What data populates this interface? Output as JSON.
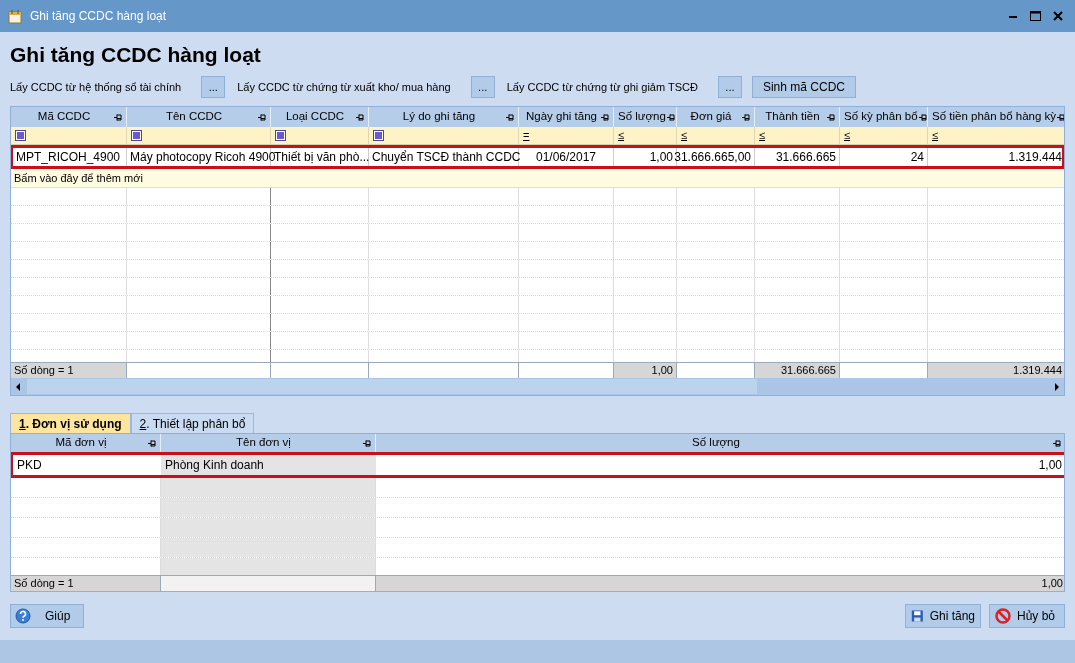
{
  "window": {
    "title": "Ghi tăng CCDC hàng loạt"
  },
  "heading": "Ghi tăng CCDC hàng loạt",
  "toolbar": [
    {
      "kind": "label",
      "text": "Lấy CCDC từ hệ thống sổ tài chính"
    },
    {
      "kind": "picker",
      "text": "..."
    },
    {
      "kind": "label",
      "text": "Lấy CCDC từ chứng từ xuất kho/ mua hàng"
    },
    {
      "kind": "picker",
      "text": "..."
    },
    {
      "kind": "label",
      "text": "Lấy CCDC từ chứng từ ghi giảm TSCĐ"
    },
    {
      "kind": "picker",
      "text": "..."
    },
    {
      "kind": "button",
      "text": "Sinh mã CCDC"
    }
  ],
  "main_grid": {
    "columns": [
      {
        "label": "Mã CCDC",
        "filter": {
          "kind": "checkbox",
          "checked": true
        }
      },
      {
        "label": "Tên CCDC",
        "filter": {
          "kind": "checkbox",
          "checked": true
        }
      },
      {
        "label": "Loại CCDC",
        "filter": {
          "kind": "checkbox",
          "checked": true
        }
      },
      {
        "label": "Lý do ghi tăng",
        "filter": {
          "kind": "checkbox",
          "checked": true
        }
      },
      {
        "label": "Ngày ghi tăng",
        "filter": {
          "kind": "operator",
          "symbol": "="
        }
      },
      {
        "label": "Số lượng",
        "filter": {
          "kind": "operator",
          "symbol": "≤"
        }
      },
      {
        "label": "Đơn giá",
        "filter": {
          "kind": "operator",
          "symbol": "≤"
        }
      },
      {
        "label": "Thành tiền",
        "filter": {
          "kind": "operator",
          "symbol": "≤"
        }
      },
      {
        "label": "Số kỳ phân bổ",
        "filter": {
          "kind": "operator",
          "symbol": "≤"
        }
      },
      {
        "label": "Số tiền phân bổ hàng kỳ",
        "filter": {
          "kind": "operator",
          "symbol": "≤"
        }
      }
    ],
    "rows": [
      {
        "selected": true,
        "cells": [
          "MPT_RICOH_4900",
          "Máy photocopy Ricoh 4900",
          "Thiết bị văn phò...",
          "Chuyển TSCĐ thành CCDC",
          "01/06/2017",
          "1,00",
          "31.666.665,00",
          "31.666.665",
          "24",
          "1.319.444"
        ]
      }
    ],
    "new_row_hint": "Bấm vào đây để thêm mới",
    "footer": [
      {
        "text": "Số dòng = 1",
        "shaded": true
      },
      {
        "shaded": false
      },
      {
        "shaded": false
      },
      {
        "shaded": false
      },
      {
        "shaded": false
      },
      {
        "text": "1,00",
        "shaded": true
      },
      {
        "shaded": false
      },
      {
        "text": "31.666.665",
        "shaded": true
      },
      {
        "shaded": false
      },
      {
        "text": "1.319.444",
        "shaded": true
      }
    ]
  },
  "tabs": [
    {
      "key": "1",
      "label": ". Đơn vị sử dụng",
      "selected": true
    },
    {
      "key": "2",
      "label": ". Thiết lập phân bổ",
      "selected": false
    }
  ],
  "unit_grid": {
    "columns": [
      {
        "label": "Mã đơn vị",
        "readonly": false
      },
      {
        "label": "Tên đơn vị",
        "readonly": true
      },
      {
        "label": "Số lượng",
        "readonly": false
      }
    ],
    "rows": [
      {
        "selected": true,
        "cells": [
          "PKD",
          "Phòng Kinh doanh",
          "1,00"
        ]
      }
    ],
    "footer": {
      "row_count": "Số dòng = 1",
      "total_quantity": "1,00"
    }
  },
  "buttons": [
    {
      "kind": "help",
      "label": "Giúp"
    },
    {
      "kind": "save",
      "label": "Ghi tăng"
    },
    {
      "kind": "cancel",
      "label": "Hủy bỏ"
    }
  ]
}
